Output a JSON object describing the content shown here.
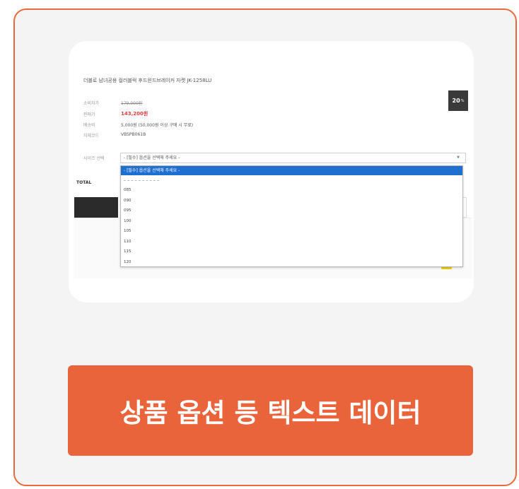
{
  "product": {
    "title": "더블로 남녀공용 컬러블럭 후드윈드브레이커 자켓 JK-1258LU",
    "rows": [
      {
        "label": "소비자가",
        "value": "179,000원"
      },
      {
        "label": "판매가",
        "value": "143,200원"
      },
      {
        "label": "배송비",
        "value": "5,000원 (50,000원 이상 구매 시 무료)"
      },
      {
        "label": "자체코드",
        "value": "VBSPB061B"
      },
      {
        "label": "사이즈 선택",
        "value": ""
      }
    ],
    "discount_value": "20",
    "discount_unit": "%",
    "select_placeholder": "- [필수] 옵션을 선택해 주세요 -",
    "total_label": "TOTAL"
  },
  "dropdown": {
    "selected": "- [필수] 옵션을 선택해 주세요 -",
    "options": [
      "085",
      "090",
      "095",
      "100",
      "105",
      "110",
      "115",
      "120"
    ]
  },
  "caption": "상품 옵션 등 텍스트 데이터",
  "colors": {
    "accent": "#e9643a",
    "select_blue": "#1f6fd1"
  }
}
